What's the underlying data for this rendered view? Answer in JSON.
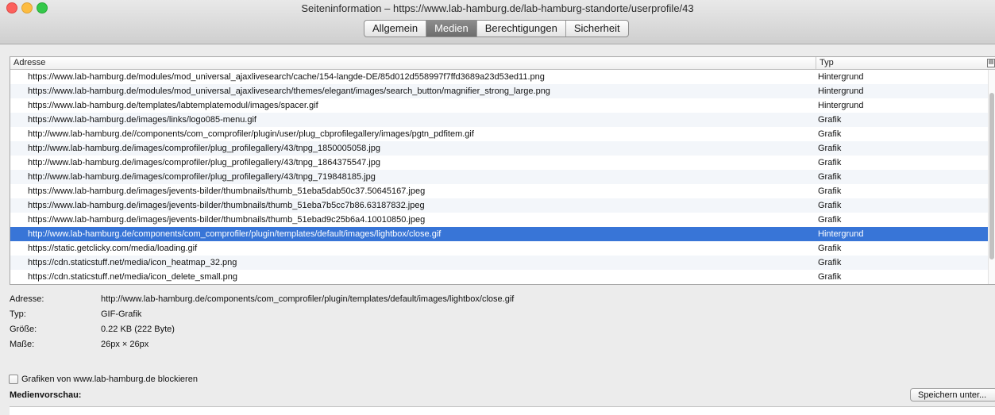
{
  "window": {
    "title": "Seiteninformation – https://www.lab-hamburg.de/lab-hamburg-standorte/userprofile/43"
  },
  "tabs": [
    {
      "label": "Allgemein",
      "active": false
    },
    {
      "label": "Medien",
      "active": true
    },
    {
      "label": "Berechtigungen",
      "active": false
    },
    {
      "label": "Sicherheit",
      "active": false
    }
  ],
  "table": {
    "headers": {
      "address": "Adresse",
      "type": "Typ"
    },
    "rows": [
      {
        "address": "https://www.lab-hamburg.de/modules/mod_universal_ajaxlivesearch/cache/154-langde-DE/85d012d558997f7ffd3689a23d53ed11.png",
        "type": "Hintergrund"
      },
      {
        "address": "https://www.lab-hamburg.de/modules/mod_universal_ajaxlivesearch/themes/elegant/images/search_button/magnifier_strong_large.png",
        "type": "Hintergrund"
      },
      {
        "address": "https://www.lab-hamburg.de/templates/labtemplatemodul/images/spacer.gif",
        "type": "Hintergrund"
      },
      {
        "address": "https://www.lab-hamburg.de/images/links/logo085-menu.gif",
        "type": "Grafik"
      },
      {
        "address": "http://www.lab-hamburg.de//components/com_comprofiler/plugin/user/plug_cbprofilegallery/images/pgtn_pdfitem.gif",
        "type": "Grafik"
      },
      {
        "address": "http://www.lab-hamburg.de/images/comprofiler/plug_profilegallery/43/tnpg_1850005058.jpg",
        "type": "Grafik"
      },
      {
        "address": "http://www.lab-hamburg.de/images/comprofiler/plug_profilegallery/43/tnpg_1864375547.jpg",
        "type": "Grafik"
      },
      {
        "address": "http://www.lab-hamburg.de/images/comprofiler/plug_profilegallery/43/tnpg_719848185.jpg",
        "type": "Grafik"
      },
      {
        "address": "https://www.lab-hamburg.de/images/jevents-bilder/thumbnails/thumb_51eba5dab50c37.50645167.jpeg",
        "type": "Grafik"
      },
      {
        "address": "https://www.lab-hamburg.de/images/jevents-bilder/thumbnails/thumb_51eba7b5cc7b86.63187832.jpeg",
        "type": "Grafik"
      },
      {
        "address": "https://www.lab-hamburg.de/images/jevents-bilder/thumbnails/thumb_51ebad9c25b6a4.10010850.jpeg",
        "type": "Grafik"
      },
      {
        "address": "http://www.lab-hamburg.de/components/com_comprofiler/plugin/templates/default/images/lightbox/close.gif",
        "type": "Hintergrund",
        "selected": true
      },
      {
        "address": "https://static.getclicky.com/media/loading.gif",
        "type": "Grafik"
      },
      {
        "address": "https://cdn.staticstuff.net/media/icon_heatmap_32.png",
        "type": "Grafik"
      },
      {
        "address": "https://cdn.staticstuff.net/media/icon_delete_small.png",
        "type": "Grafik"
      }
    ]
  },
  "details": {
    "address_label": "Adresse:",
    "address_value": "http://www.lab-hamburg.de/components/com_comprofiler/plugin/templates/default/images/lightbox/close.gif",
    "type_label": "Typ:",
    "type_value": "GIF-Grafik",
    "size_label": "Größe:",
    "size_value": "0.22 KB (222 Byte)",
    "dimensions_label": "Maße:",
    "dimensions_value": "26px × 26px"
  },
  "block_images_label": "Grafiken von www.lab-hamburg.de blockieren",
  "preview_label": "Medienvorschau:",
  "save_button_label": "Speichern unter..."
}
